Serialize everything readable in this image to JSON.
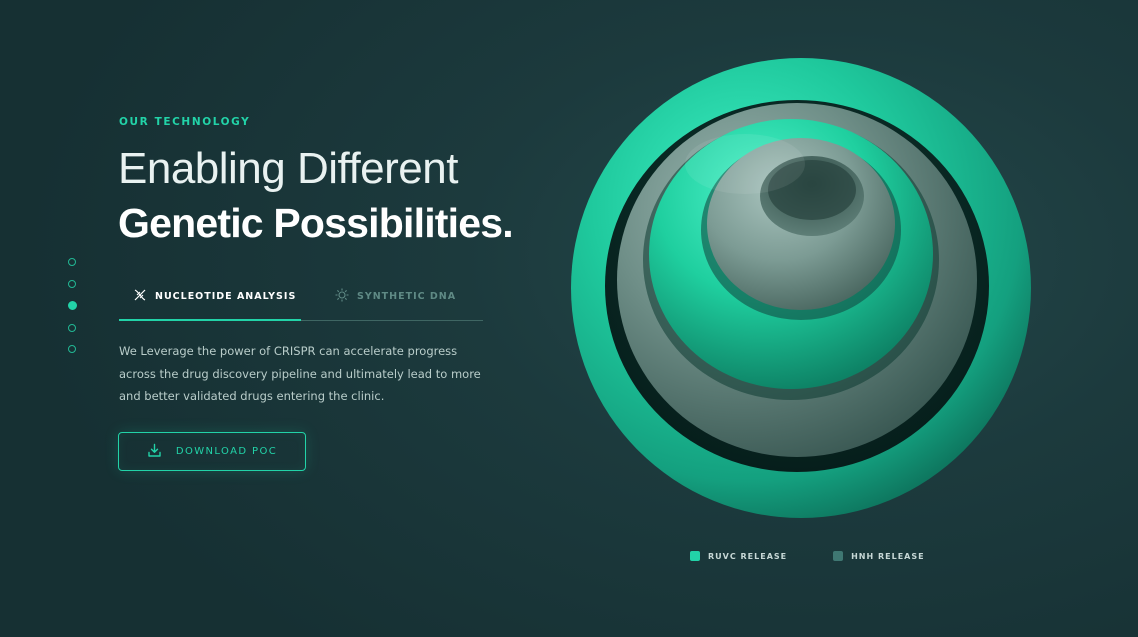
{
  "hero": {
    "eyebrow": "OUR TECHNOLOGY",
    "title_line1": "Enabling Different",
    "title_line2": "Genetic Possibilities.",
    "description": "We Leverage the power of CRISPR can accelerate progress across the drug discovery pipeline and ultimately lead to more and better validated drugs entering the clinic.",
    "cta_label": "DOWNLOAD POC"
  },
  "tabs": [
    {
      "label": "NUCLEOTIDE ANALYSIS",
      "icon": "dna-helix-icon",
      "active": true
    },
    {
      "label": "SYNTHETIC DNA",
      "icon": "sun-molecule-icon",
      "active": false
    }
  ],
  "pager": {
    "count": 5,
    "active_index": 2
  },
  "legend": [
    {
      "label": "RUVC RELEASE",
      "color": "#22d3a8"
    },
    {
      "label": "HNH RELEASE",
      "color": "#3f7772"
    }
  ],
  "colors": {
    "accent": "#22d3a8",
    "background": "#1c3a3d",
    "muted_teal": "#3f7772"
  }
}
